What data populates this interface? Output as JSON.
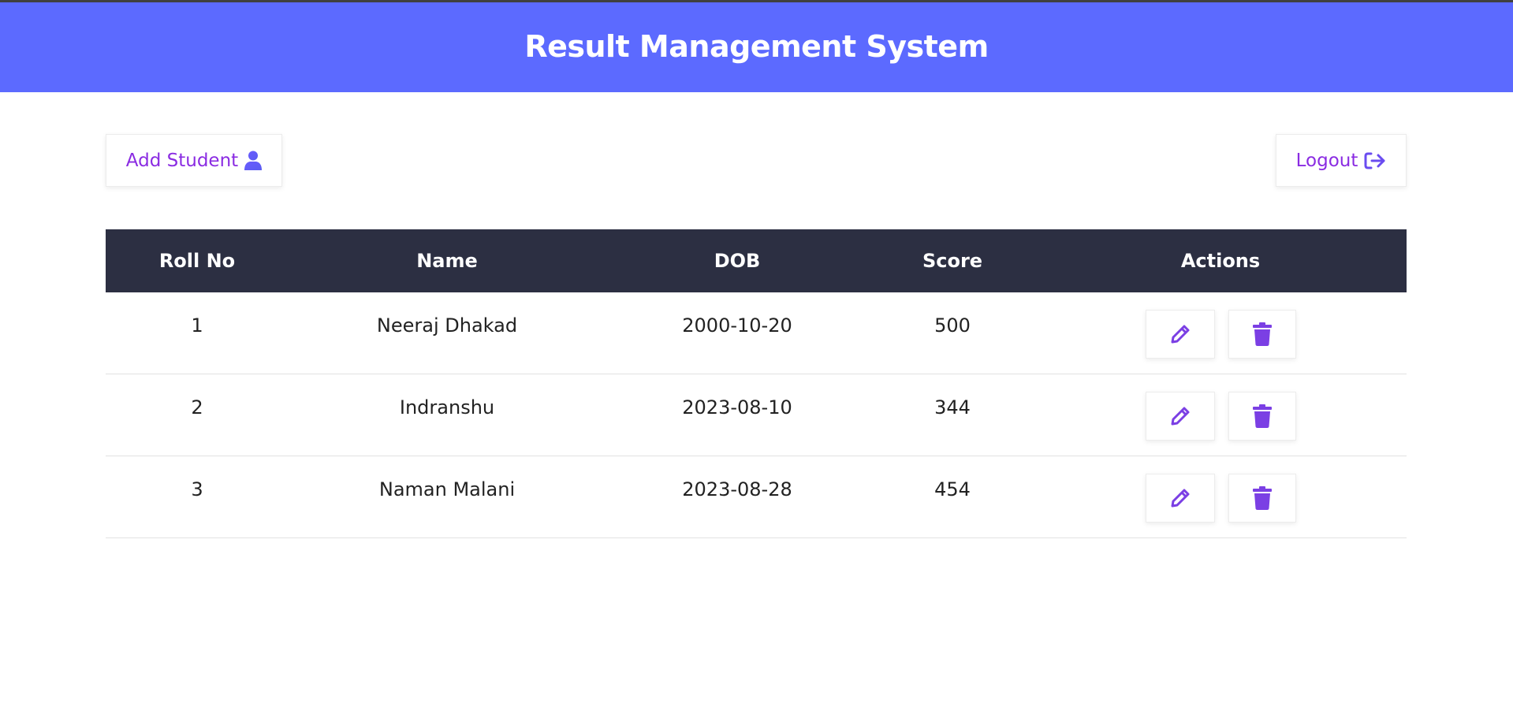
{
  "header": {
    "title": "Result Management System"
  },
  "toolbar": {
    "add_label": "Add Student",
    "logout_label": "Logout"
  },
  "table": {
    "columns": [
      "Roll No",
      "Name",
      "DOB",
      "Score",
      "Actions"
    ],
    "rows": [
      {
        "roll": "1",
        "name": "Neeraj Dhakad",
        "dob": "2000-10-20",
        "score": "500"
      },
      {
        "roll": "2",
        "name": "Indranshu",
        "dob": "2023-08-10",
        "score": "344"
      },
      {
        "roll": "3",
        "name": "Naman Malani",
        "dob": "2023-08-28",
        "score": "454"
      }
    ]
  },
  "icons": {
    "add": "user-icon",
    "logout": "sign-out-icon",
    "edit": "pencil-icon",
    "delete": "trash-icon"
  },
  "colors": {
    "header_bg": "#5c6aff",
    "table_head_bg": "#2c2f42",
    "accent": "#8a2be2"
  }
}
